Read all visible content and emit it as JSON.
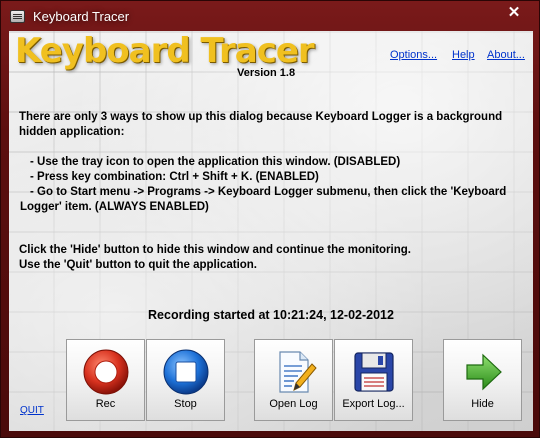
{
  "window": {
    "title": "Keyboard Tracer",
    "close_label": "✕"
  },
  "header": {
    "logo_text": "Keyboard Tracer",
    "version": "Version 1.8",
    "links": {
      "options": "Options...",
      "help": "Help",
      "about": "About..."
    }
  },
  "body": {
    "intro_line1": "There are only 3 ways to show up this dialog because Keyboard Logger is a background",
    "intro_line2": "hidden application:",
    "ways": [
      "- Use the tray icon to open the application this window. (DISABLED)",
      "- Press key combination: Ctrl + Shift + K. (ENABLED)",
      "- Go to Start menu -> Programs -> Keyboard Logger submenu, then click the 'Keyboard",
      "Logger' item. (ALWAYS ENABLED)"
    ],
    "hint_line1": "Click the 'Hide' button to hide this window and continue the monitoring.",
    "hint_line2": "Use the 'Quit' button to quit the application."
  },
  "status": "Recording started at 10:21:24, 12-02-2012",
  "buttons": {
    "rec": "Rec",
    "stop": "Stop",
    "open_log": "Open Log",
    "export_log": "Export Log...",
    "hide": "Hide"
  },
  "quit_label": "QUIT",
  "colors": {
    "frame": "#5c0f0f",
    "logo": "#f0c020",
    "link": "#0033cc",
    "rec": "#d8321f",
    "stop": "#1e72d8",
    "hide_arrow": "#3aa524"
  }
}
